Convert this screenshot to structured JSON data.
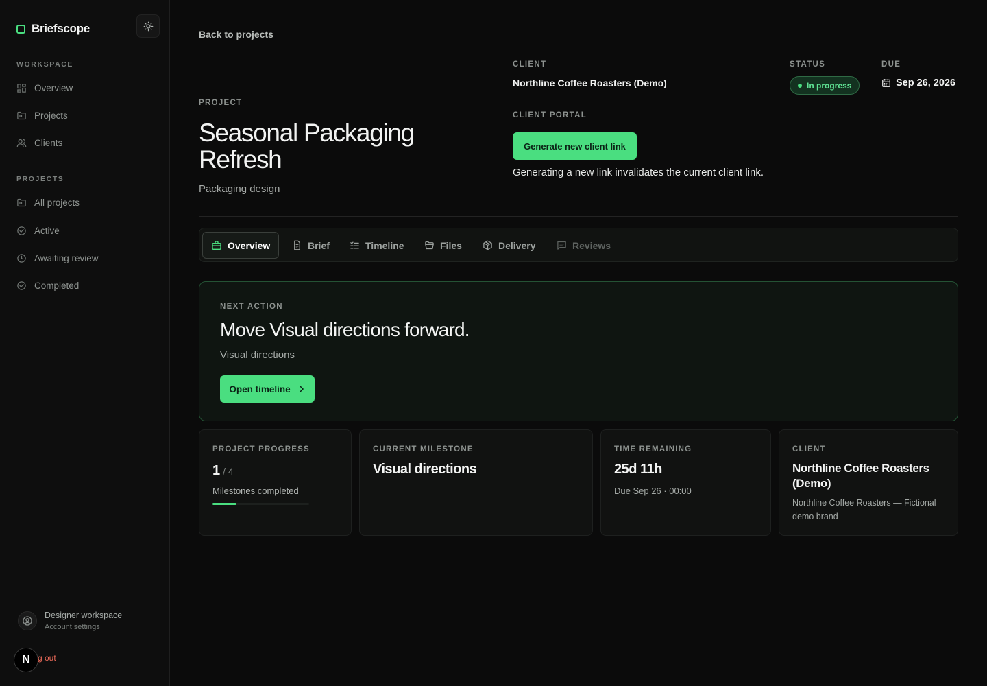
{
  "app": {
    "name": "Briefscope",
    "accent": "#4ade80"
  },
  "sidebar": {
    "workspace_label": "WORKSPACE",
    "workspace_items": [
      {
        "label": "Overview",
        "icon": "grid-icon"
      },
      {
        "label": "Projects",
        "icon": "folder-icon"
      },
      {
        "label": "Clients",
        "icon": "users-icon"
      }
    ],
    "projects_label": "PROJECTS",
    "project_items": [
      {
        "label": "All projects",
        "icon": "folder-icon"
      },
      {
        "label": "Active",
        "icon": "check-circle-icon"
      },
      {
        "label": "Awaiting review",
        "icon": "clock-icon"
      },
      {
        "label": "Completed",
        "icon": "check-circle-icon"
      }
    ],
    "account": {
      "name": "Designer workspace",
      "settings": "Account settings"
    },
    "logout": "g out",
    "n_badge": "N"
  },
  "header": {
    "back": "Back to projects",
    "project_label": "PROJECT",
    "project_title": "Seasonal Packaging Refresh",
    "project_subtitle": "Packaging design",
    "client_label": "CLIENT",
    "client_name": "Northline Coffee Roasters (Demo)",
    "portal_label": "CLIENT PORTAL",
    "generate_button": "Generate new client link",
    "portal_note": "Generating a new link invalidates the current client link.",
    "status_label": "STATUS",
    "status_value": "In progress",
    "due_label": "DUE",
    "due_value": "Sep 26, 2026"
  },
  "tabs": [
    {
      "label": "Overview",
      "icon": "briefcase-icon",
      "active": true
    },
    {
      "label": "Brief",
      "icon": "document-icon"
    },
    {
      "label": "Timeline",
      "icon": "list-check-icon"
    },
    {
      "label": "Files",
      "icon": "folder-open-icon"
    },
    {
      "label": "Delivery",
      "icon": "package-icon"
    },
    {
      "label": "Reviews",
      "icon": "message-icon",
      "disabled": true
    }
  ],
  "next_action": {
    "label": "NEXT ACTION",
    "title": "Move Visual directions forward.",
    "subtitle": "Visual directions",
    "button": "Open timeline"
  },
  "stats": {
    "progress": {
      "label": "PROJECT PROGRESS",
      "completed": "1",
      "total": "/ 4",
      "caption": "Milestones completed",
      "fraction": 0.25
    },
    "milestone": {
      "label": "CURRENT MILESTONE",
      "value": "Visual directions"
    },
    "time": {
      "label": "TIME REMAINING",
      "value": "25d 11h",
      "caption": "Due Sep 26 · 00:00"
    },
    "client": {
      "label": "CLIENT",
      "name": "Northline Coffee Roasters (Demo)",
      "description": "Northline Coffee Roasters — Fictional demo brand"
    }
  }
}
